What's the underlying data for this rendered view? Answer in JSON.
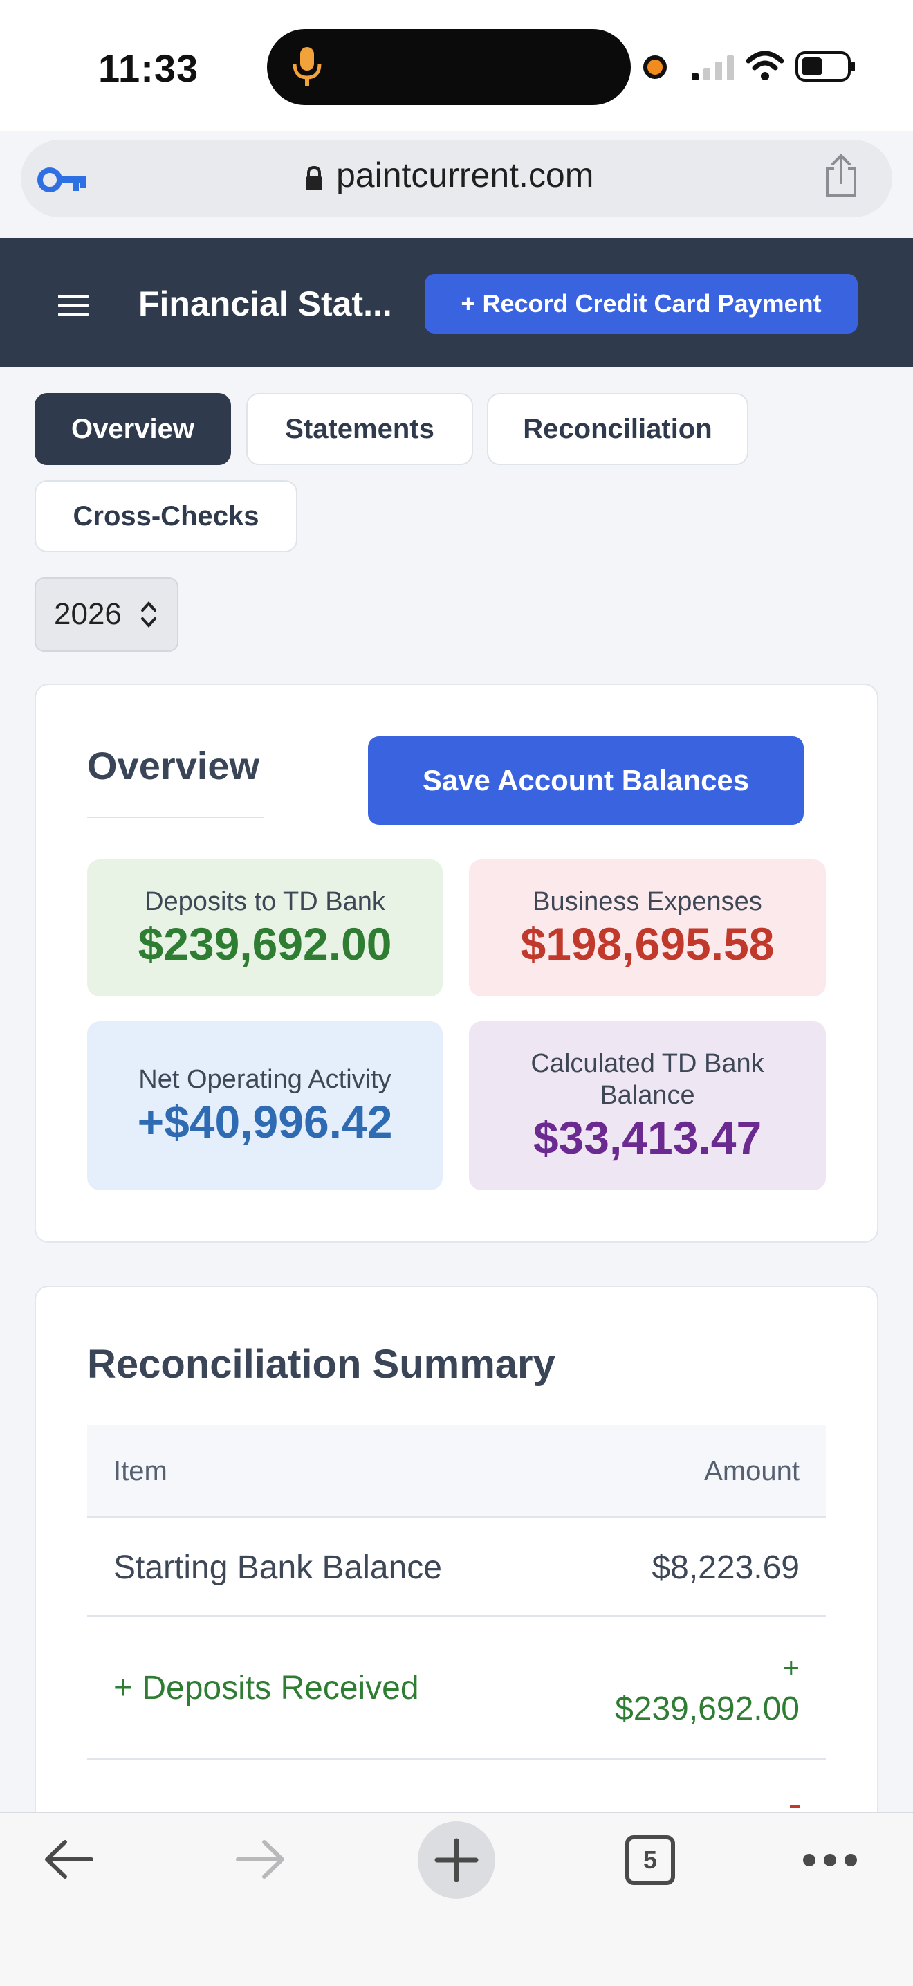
{
  "status_bar": {
    "time": "11:33"
  },
  "browser": {
    "url": "paintcurrent.com",
    "tab_count": "5"
  },
  "header": {
    "title": "Financial Stat...",
    "record_button": "+ Record Credit Card Payment"
  },
  "tabs": [
    {
      "label": "Overview",
      "active": true
    },
    {
      "label": "Statements",
      "active": false
    },
    {
      "label": "Reconciliation",
      "active": false
    },
    {
      "label": "Cross-Checks",
      "active": false
    }
  ],
  "year_select": {
    "value": "2026"
  },
  "overview": {
    "title": "Overview",
    "save_button": "Save Account Balances",
    "metrics": [
      {
        "label": "Deposits to TD Bank",
        "value": "$239,692.00",
        "bg": "#e8f3e6",
        "color": "#2e7d32"
      },
      {
        "label": "Business Expenses",
        "value": "$198,695.58",
        "bg": "#fbe9ec",
        "color": "#c0392b"
      },
      {
        "label": "Net Operating Activity",
        "value": "+$40,996.42",
        "bg": "#e4effb",
        "color": "#2f6bb3"
      },
      {
        "label": "Calculated TD Bank Balance",
        "value": "$33,413.47",
        "bg": "#efe6f3",
        "color": "#6a2a90"
      }
    ]
  },
  "reconciliation_summary": {
    "title": "Reconciliation Summary",
    "columns": [
      "Item",
      "Amount"
    ],
    "rows": [
      {
        "item": "Starting Bank Balance",
        "amount": "$8,223.69"
      },
      {
        "item": "+ Deposits Received",
        "amount_sign": "+",
        "amount": "$239,692.00"
      }
    ]
  },
  "colors": {
    "header_bg": "#2f3a4c",
    "accent": "#3a63e0",
    "positive": "#2e7d32",
    "negative": "#c0392b"
  }
}
